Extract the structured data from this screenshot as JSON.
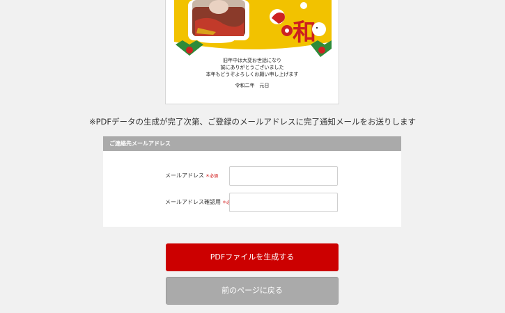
{
  "card": {
    "lines": [
      "旧年中は大変お世話になり",
      "誠にありがとうございました",
      "本年もどうぞよろしくお願い申し上げます"
    ],
    "date": "令和二年　元日",
    "kanji": "和"
  },
  "notice": "※PDFデータの生成が完了次第、ご登録のメールアドレスに完了通知メールをお送りします",
  "form": {
    "header": "ご連絡先メールアドレス",
    "required_mark": "＊必須",
    "email_label": "メールアドレス",
    "email_value": "",
    "email_confirm_label": "メールアドレス確認用",
    "email_confirm_value": ""
  },
  "buttons": {
    "generate": "PDFファイルを生成する",
    "back": "前のページに戻る"
  },
  "colors": {
    "accent_red": "#cc0000",
    "header_gray": "#aaaaaa",
    "card_yellow": "#f2c200"
  }
}
